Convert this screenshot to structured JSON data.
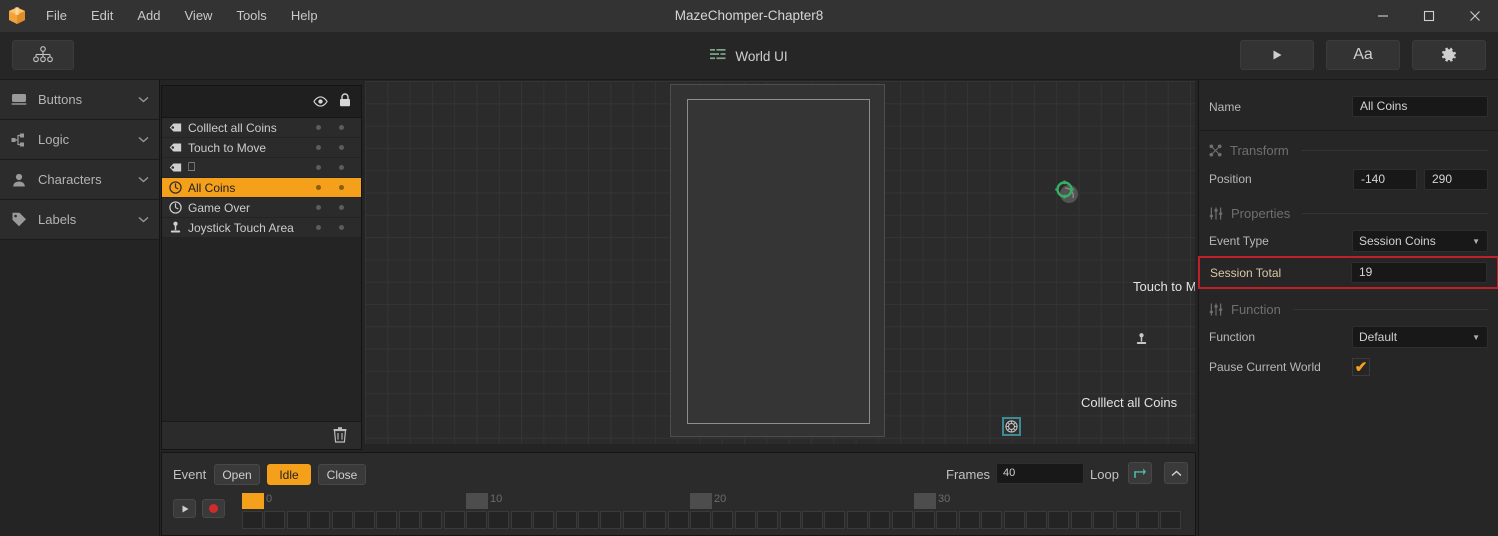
{
  "window": {
    "title": "MazeChomper-Chapter8",
    "logo_icon": "box-logo-icon",
    "minimize_icon": "minimize-icon",
    "maximize_icon": "maximize-icon",
    "close_icon": "close-icon"
  },
  "menubar": {
    "items": [
      {
        "label": "File"
      },
      {
        "label": "Edit"
      },
      {
        "label": "Add"
      },
      {
        "label": "View"
      },
      {
        "label": "Tools"
      },
      {
        "label": "Help"
      }
    ]
  },
  "toolbar": {
    "hierarchy_icon": "hierarchy-icon",
    "scene_icon": "world-ui-icon",
    "scene_label": "World UI",
    "play_icon": "play-icon",
    "text_label": "Aa",
    "settings_icon": "gear-icon"
  },
  "sidebar": {
    "items": [
      {
        "label": "Buttons",
        "icon": "button-icon",
        "chevron": "chevron-down-icon"
      },
      {
        "label": "Logic",
        "icon": "logic-icon",
        "chevron": "chevron-down-icon"
      },
      {
        "label": "Characters",
        "icon": "person-icon",
        "chevron": "chevron-down-icon"
      },
      {
        "label": "Labels",
        "icon": "tag-icon",
        "chevron": "chevron-down-icon"
      }
    ]
  },
  "layers": {
    "visibility_icon": "eye-icon",
    "lock_icon": "lock-icon",
    "delete_icon": "trash-icon",
    "items": [
      {
        "label": "Colllect all Coins",
        "icon": "label-tag-icon",
        "selected": false
      },
      {
        "label": "Touch to Move",
        "icon": "label-tag-icon",
        "selected": false
      },
      {
        "label": "⎕",
        "icon": "label-tag-icon",
        "selected": false
      },
      {
        "label": "All Coins",
        "icon": "clock-icon",
        "selected": true
      },
      {
        "label": "Game Over",
        "icon": "clock-icon",
        "selected": false
      },
      {
        "label": "Joystick Touch Area",
        "icon": "joystick-icon",
        "selected": false
      }
    ]
  },
  "canvas": {
    "selection_handle_icon": "selection-handle-icon",
    "coin_marker_icon": "coin-icon",
    "joystick_icon": "joystick-icon",
    "texts": [
      {
        "value": "Touch to Move"
      },
      {
        "value": "Colllect all Coins"
      }
    ]
  },
  "properties": {
    "name_label": "Name",
    "name_value": "All Coins",
    "transform": {
      "icon": "transform-icon",
      "title": "Transform",
      "position_label": "Position",
      "position_x": "-140",
      "position_y": "290"
    },
    "props_section": {
      "icon": "sliders-icon",
      "title": "Properties",
      "event_type_label": "Event Type",
      "event_type_value": "Session Coins",
      "session_total_label": "Session Total",
      "session_total_value": "19",
      "caret_icon": "chevron-down-icon"
    },
    "function_section": {
      "icon": "sliders-icon",
      "title": "Function",
      "function_label": "Function",
      "function_value": "Default",
      "pause_label": "Pause Current World",
      "pause_checked": "✔",
      "caret_icon": "chevron-down-icon"
    }
  },
  "timeline": {
    "event_label": "Event",
    "buttons": [
      {
        "label": "Open",
        "active": false
      },
      {
        "label": "Idle",
        "active": true
      },
      {
        "label": "Close",
        "active": false
      }
    ],
    "frames_label": "Frames",
    "frames_value": "40",
    "loop_label": "Loop",
    "loop_icon": "loop-icon",
    "collapse_icon": "chevron-up-icon",
    "play_icon": "play-icon",
    "record_icon": "record-icon",
    "tick_labels": [
      "0",
      "10",
      "20",
      "30"
    ],
    "total_cells": 42
  },
  "colors": {
    "accent": "#f5a01b",
    "highlight_border": "#c0202a",
    "teal": "#3e8a94",
    "green": "#35b163",
    "record_red": "#cf2b2b"
  }
}
